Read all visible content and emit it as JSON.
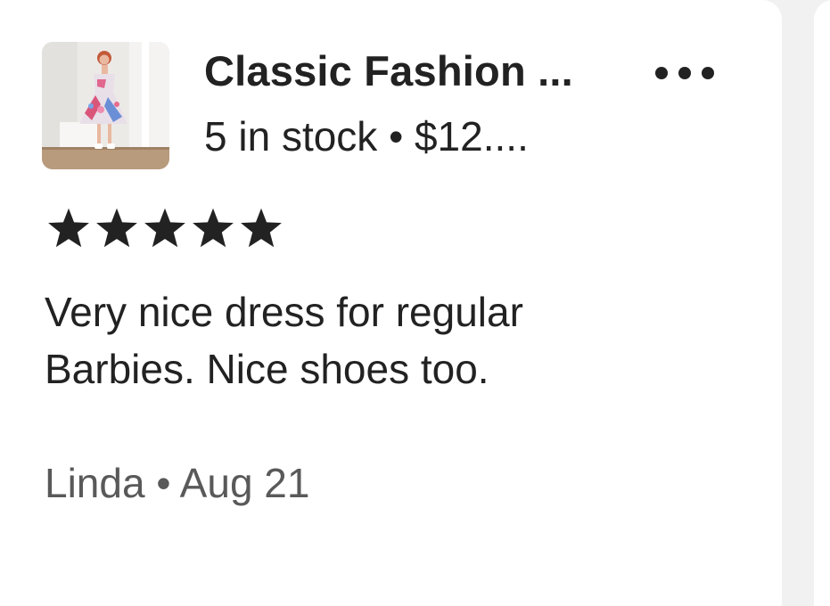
{
  "review": {
    "product_title": "Classic Fashion ...",
    "product_meta": "5 in stock • $12....",
    "rating": 5,
    "rating_max": 5,
    "text_line1": "Very nice dress for regular",
    "text_line2": "Barbies. Nice shoes too.",
    "reviewer_line": "Linda • Aug 21",
    "more_icon": "more-horizontal-icon",
    "star_icon": "star-filled-icon"
  },
  "colors": {
    "text_primary": "#222222",
    "text_secondary": "#595959",
    "card_background": "#ffffff",
    "page_background": "#f1f1f1"
  }
}
